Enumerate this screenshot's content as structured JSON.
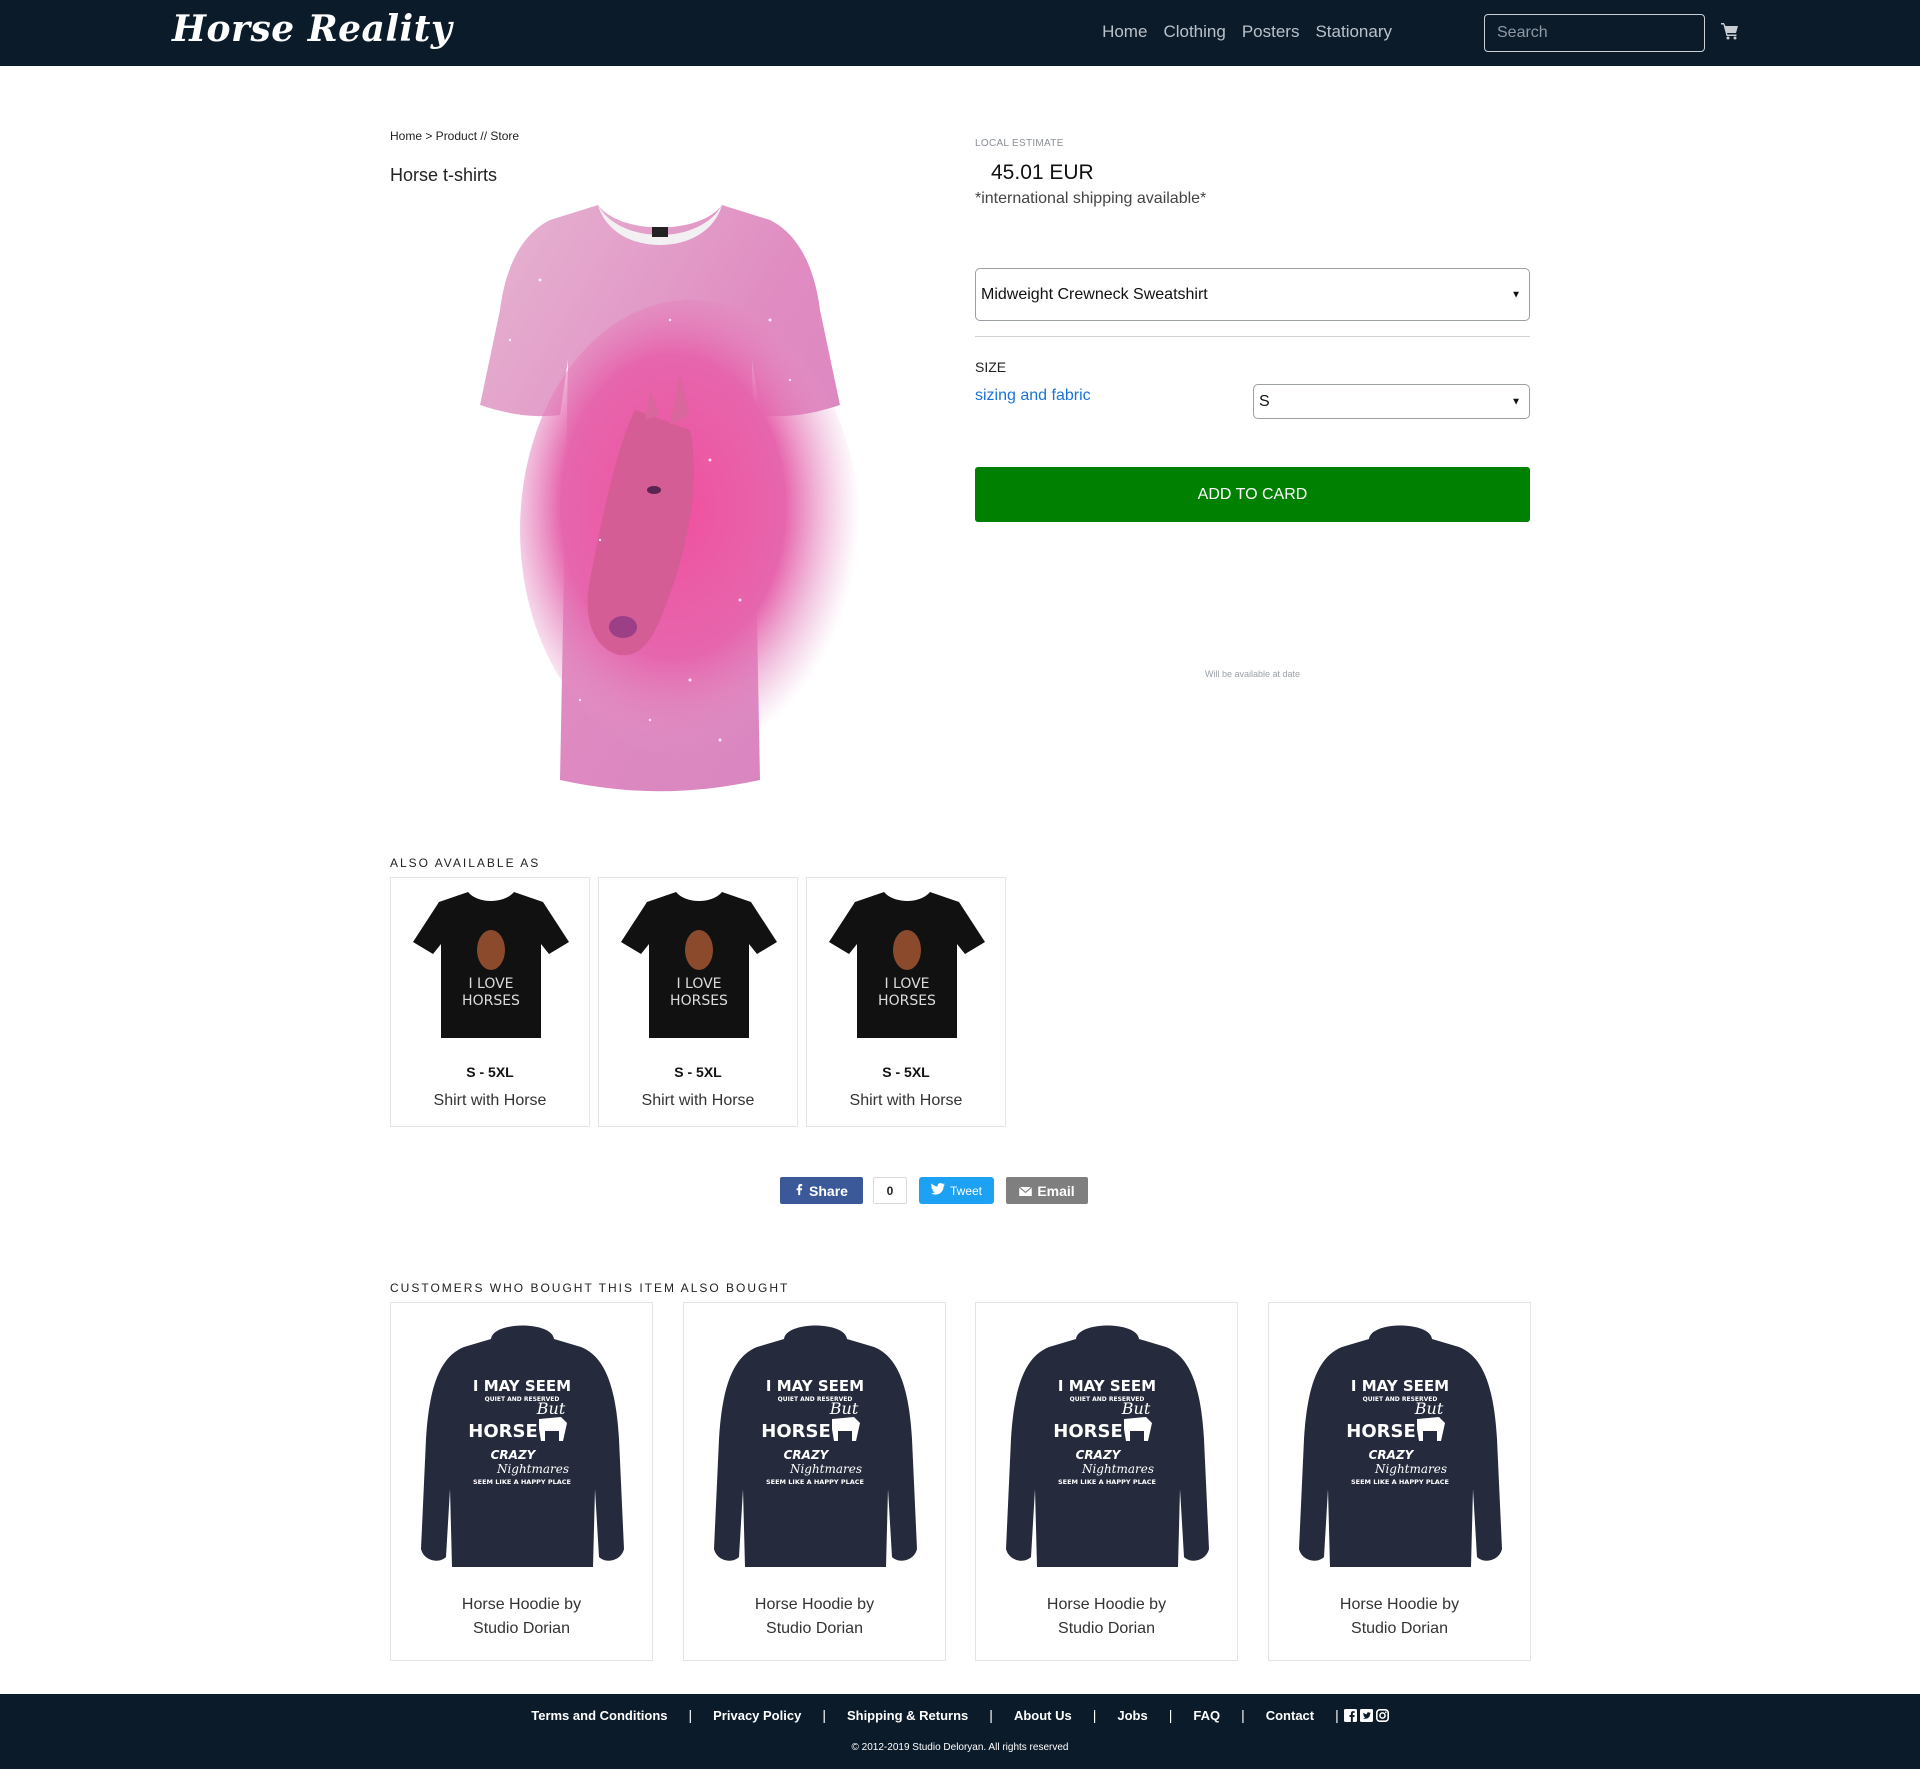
{
  "nav": {
    "logo": "Horse Reality",
    "links": [
      "Home",
      "Clothing",
      "Posters",
      "Stationary"
    ],
    "search_placeholder": "Search"
  },
  "product": {
    "breadcrumb": "Home > Product // Store",
    "title": "Horse t-shirts",
    "estimate_label": "LOCAL ESTIMATE",
    "price": "45.01 EUR",
    "shipping_note": "*international shipping available*",
    "style_selected": "Midweight Crewneck Sweatshirt",
    "size_label": "SIZE",
    "sizing_link": "sizing and fabric",
    "size_selected": "S",
    "add_button": "ADD TO CARD",
    "availability_note": "Will be available at date"
  },
  "also_available": {
    "title": "ALSO AVAILABLE AS",
    "items": [
      {
        "range": "S - 5XL",
        "name": "Shirt with Horse",
        "shirt_text": [
          "I LOVE",
          "HORSES"
        ]
      },
      {
        "range": "S - 5XL",
        "name": "Shirt with Horse",
        "shirt_text": [
          "I LOVE",
          "HORSES"
        ]
      },
      {
        "range": "S - 5XL",
        "name": "Shirt with Horse",
        "shirt_text": [
          "I LOVE",
          "HORSES"
        ]
      }
    ]
  },
  "share": {
    "facebook": "Share",
    "count": "0",
    "twitter": "Tweet",
    "email": "Email"
  },
  "also_bought": {
    "title": "CUSTOMERS WHO BOUGHT THIS ITEM ALSO BOUGHT",
    "items": [
      {
        "name_line1": "Horse Hoodie by",
        "name_line2": "Studio Dorian"
      },
      {
        "name_line1": "Horse Hoodie by",
        "name_line2": "Studio Dorian"
      },
      {
        "name_line1": "Horse Hoodie by",
        "name_line2": "Studio Dorian"
      },
      {
        "name_line1": "Horse Hoodie by",
        "name_line2": "Studio Dorian"
      }
    ],
    "hoodie_text": [
      "I MAY SEEM",
      "QUIET AND RESERVED",
      "But",
      "HORSE",
      "CRAZY",
      "Nightmares",
      "SEEM LIKE A HAPPY PLACE"
    ]
  },
  "footer": {
    "links": [
      "Terms and Conditions",
      "Privacy Policy",
      "Shipping & Returns",
      "About Us",
      "Jobs",
      "FAQ",
      "Contact"
    ],
    "separator": "|",
    "copyright": "© 2012-2019 Studio Deloryan. All rights reserved"
  },
  "icons": {
    "cart": "cart-icon",
    "facebook": "facebook-icon",
    "twitter": "twitter-icon",
    "email": "envelope-icon",
    "instagram": "instagram-icon"
  },
  "colors": {
    "navbar": "#0c1b2a",
    "add_button": "#008000",
    "link": "#1a73d9",
    "facebook": "#3b5998",
    "twitter": "#1da1f2",
    "email": "#7f7f7f"
  }
}
